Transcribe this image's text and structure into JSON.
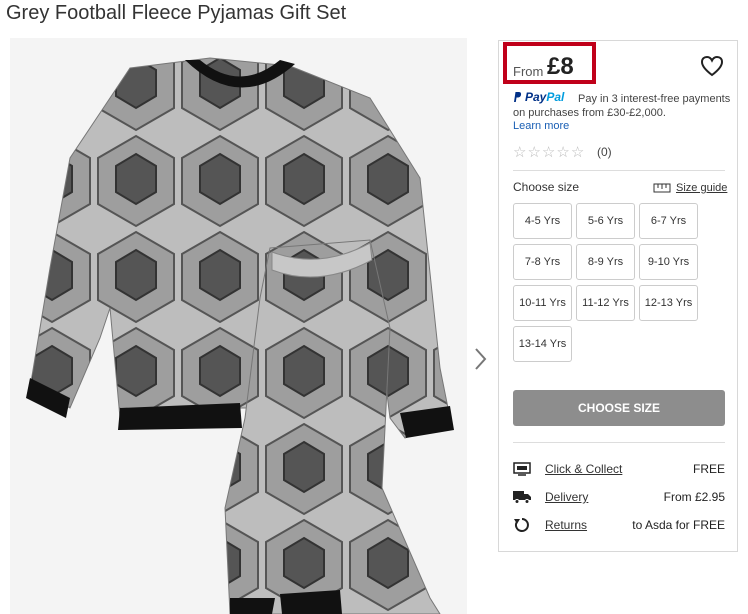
{
  "product": {
    "title": "Grey Football Fleece Pyjamas Gift Set"
  },
  "price": {
    "from_label": "From",
    "value": "£8"
  },
  "paypal": {
    "logo_pay": "Pay",
    "logo_pal": "Pal",
    "text": "Pay in 3 interest-free payments on purchases from £30-£2,000.",
    "learn_more": "Learn more"
  },
  "rating": {
    "stars_filled": 0,
    "stars_total": 5,
    "count": "(0)"
  },
  "size_section": {
    "label": "Choose size",
    "guide": "Size guide",
    "options": [
      "4-5 Yrs",
      "5-6 Yrs",
      "6-7 Yrs",
      "7-8 Yrs",
      "8-9 Yrs",
      "9-10 Yrs",
      "10-11 Yrs",
      "11-12 Yrs",
      "12-13 Yrs",
      "13-14 Yrs"
    ]
  },
  "cta": {
    "label": "CHOOSE SIZE"
  },
  "delivery": [
    {
      "icon": "click-collect-icon",
      "label": "Click & Collect",
      "value": "FREE"
    },
    {
      "icon": "truck-icon",
      "label": "Delivery",
      "value": "From £2.95"
    },
    {
      "icon": "returns-icon",
      "label": "Returns",
      "value": "to Asda for FREE"
    }
  ],
  "colors": {
    "accent_red": "#c0001a",
    "button_grey": "#8d8d8d",
    "paypal_blue": "#003087",
    "paypal_light": "#009cde"
  }
}
